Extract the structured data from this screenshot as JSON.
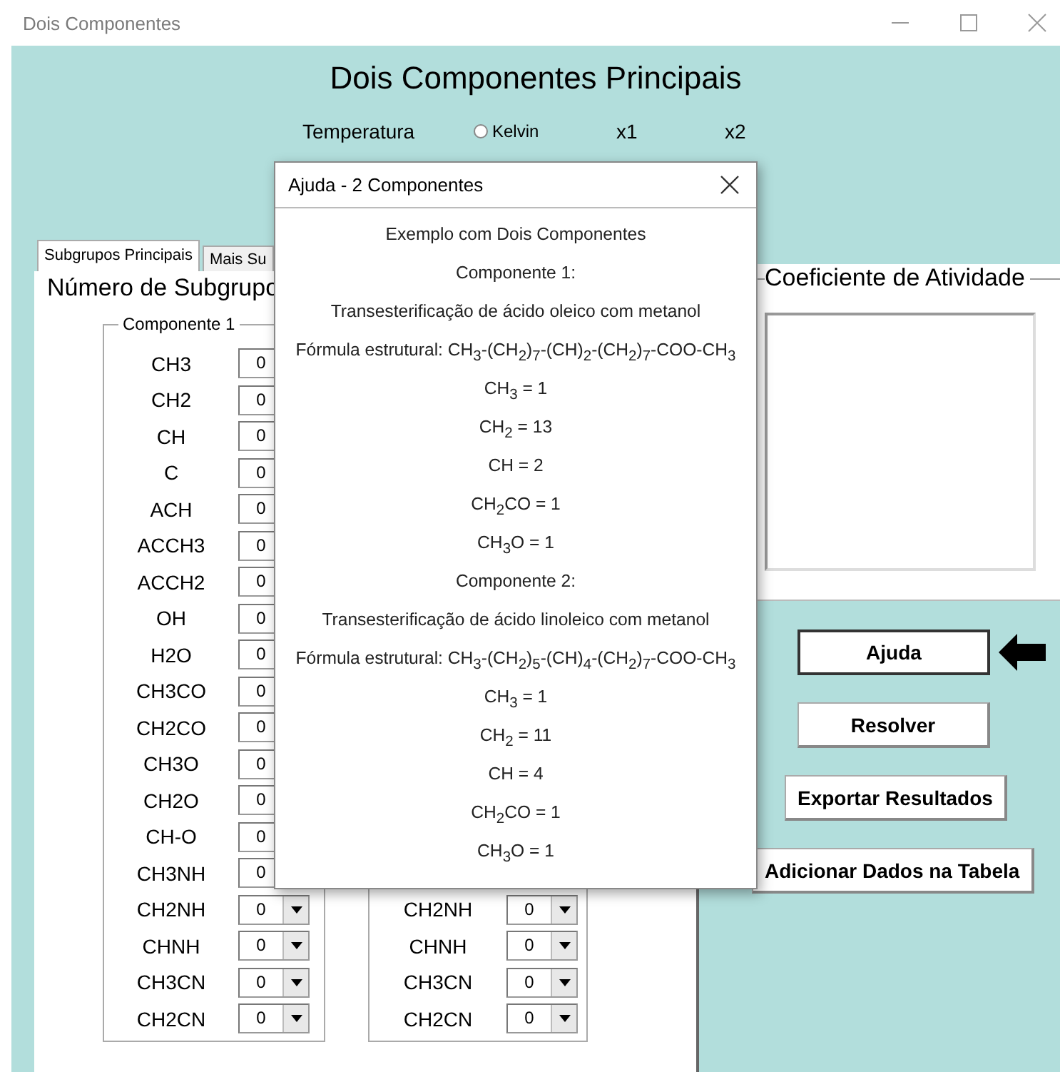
{
  "window": {
    "title": "Dois Componentes"
  },
  "heading": "Dois Componentes Principais",
  "temperature": {
    "label": "Temperatura",
    "unit_option": {
      "label": "Kelvin",
      "selected": false
    },
    "column_1": "x1",
    "column_2": "x2"
  },
  "tabs": [
    {
      "label": "Subgrupos Principais",
      "selected": true
    },
    {
      "label": "Mais Su",
      "selected": false
    }
  ],
  "subgroups_heading": "Número de Subgrupo",
  "component_1": {
    "title": "Componente 1",
    "rows": [
      {
        "name": "CH3",
        "value": "0"
      },
      {
        "name": "CH2",
        "value": "0"
      },
      {
        "name": "CH",
        "value": "0"
      },
      {
        "name": "C",
        "value": "0"
      },
      {
        "name": "ACH",
        "value": "0"
      },
      {
        "name": "ACCH3",
        "value": "0"
      },
      {
        "name": "ACCH2",
        "value": "0"
      },
      {
        "name": "OH",
        "value": "0"
      },
      {
        "name": "H2O",
        "value": "0"
      },
      {
        "name": "CH3CO",
        "value": "0"
      },
      {
        "name": "CH2CO",
        "value": "0"
      },
      {
        "name": "CH3O",
        "value": "0"
      },
      {
        "name": "CH2O",
        "value": "0"
      },
      {
        "name": "CH-O",
        "value": "0"
      },
      {
        "name": "CH3NH",
        "value": "0"
      },
      {
        "name": "CH2NH",
        "value": "0"
      },
      {
        "name": "CHNH",
        "value": "0"
      },
      {
        "name": "CH3CN",
        "value": "0"
      },
      {
        "name": "CH2CN",
        "value": "0"
      }
    ]
  },
  "component_2": {
    "rows": [
      {
        "name": "CH2NH",
        "value": "0"
      },
      {
        "name": "CHNH",
        "value": "0"
      },
      {
        "name": "CH3CN",
        "value": "0"
      },
      {
        "name": "CH2CN",
        "value": "0"
      }
    ]
  },
  "activity": {
    "title": "Coeficiente de Atividade"
  },
  "buttons": [
    {
      "label": "Ajuda",
      "pointed": true
    },
    {
      "label": "Resolver",
      "pointed": false
    },
    {
      "label": "Exportar Resultados",
      "pointed": false
    },
    {
      "label": "Adicionar Dados na Tabela",
      "pointed": false
    }
  ],
  "dialog": {
    "title": "Ajuda - 2 Componentes",
    "lines": [
      "Exemplo com Dois Componentes",
      "Componente 1:",
      "Transesterificação de ácido oleico com metanol",
      "Fórmula estrutural: CH$_{3}$-(CH$_{2}$)$_{7}$-(CH)$_{2}$-(CH$_{2}$)$_{7}$-COO-CH$_{3}$",
      "CH$_{3}$ = 1",
      "CH$_{2}$ = 13",
      "CH = 2",
      "CH$_{2}$CO = 1",
      "CH$_{3}$O = 1",
      "Componente 2:",
      "Transesterificação de ácido linoleico com metanol",
      "Fórmula estrutural: CH$_{3}$-(CH$_{2}$)$_{5}$-(CH)$_{4}$-(CH$_{2}$)$_{7}$-COO-CH$_{3}$",
      "CH$_{3}$ = 1",
      "CH$_{2}$ = 11",
      "CH = 4",
      "CH$_{2}$CO = 1",
      "CH$_{3}$O = 1"
    ]
  }
}
